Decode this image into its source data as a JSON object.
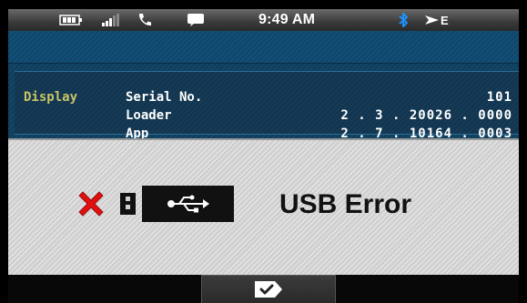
{
  "status_bar": {
    "time": "9:49 AM",
    "output_indicator": "E",
    "icons": [
      "battery-icon",
      "signal-icon",
      "phone-icon",
      "chat-icon",
      "bluetooth-icon",
      "output-arrow-icon"
    ],
    "colors": {
      "bluetooth": "#1e90ff"
    }
  },
  "info": {
    "section_label": "Display",
    "rows": [
      {
        "label": "Serial No.",
        "value": "101"
      },
      {
        "label": "Loader",
        "value": "2 . 3 . 20026 . 0000"
      },
      {
        "label": "App",
        "value": "2 . 7 . 10164 . 0003"
      }
    ]
  },
  "error": {
    "message": "USB Error",
    "icons": [
      "error-x-icon",
      "device-icon",
      "usb-icon"
    ],
    "colors": {
      "error_x": "#e01010"
    }
  },
  "footer": {
    "ok_icon": "confirm-tag-icon"
  }
}
